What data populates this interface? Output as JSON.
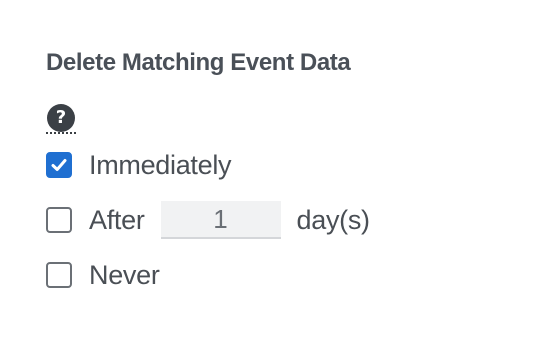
{
  "section": {
    "title": "Delete Matching Event Data",
    "help_glyph": "?"
  },
  "options": [
    {
      "label": "Immediately",
      "checked": true
    },
    {
      "label": "After",
      "checked": false
    },
    {
      "label": "Never",
      "checked": false
    }
  ],
  "after_input": {
    "value": "1",
    "unit": "day(s)"
  },
  "colors": {
    "accent": "#1f6fd1",
    "text": "#4a4f55",
    "input_bg": "#f1f2f3"
  }
}
